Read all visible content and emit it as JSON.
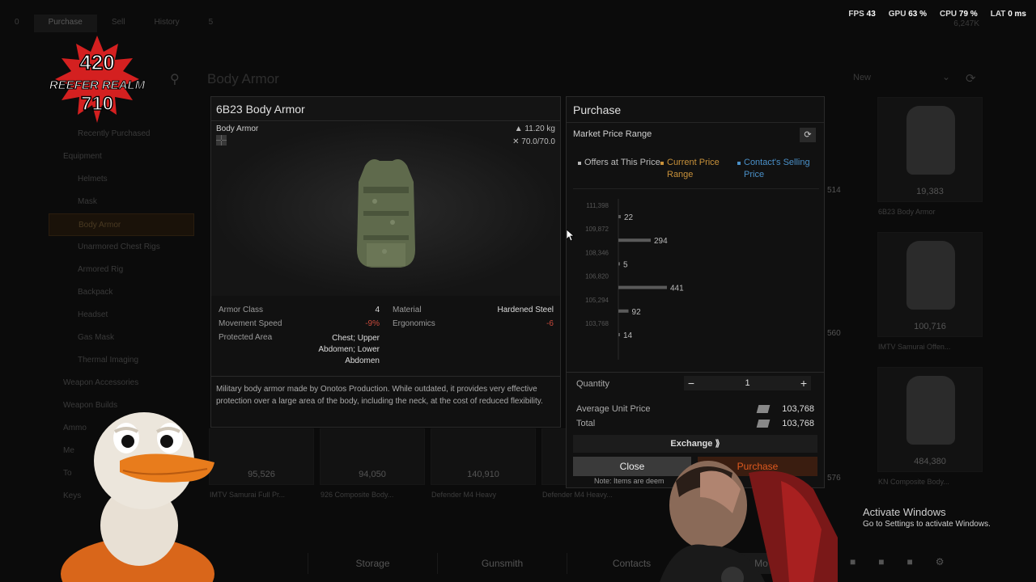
{
  "top_tabs": [
    "0",
    "Purchase",
    "Sell",
    "History",
    "5"
  ],
  "perf": {
    "fps_label": "FPS",
    "fps": "43",
    "gpu_label": "GPU",
    "gpu": "63 %",
    "cpu_label": "CPU",
    "cpu": "79 %",
    "lat_label": "LAT",
    "lat": "0 ms"
  },
  "money_top": "6,247K",
  "background": {
    "page_title": "Body Armor",
    "filter_value": "New",
    "sidebar": {
      "items": [
        {
          "label": "Recently Purchased",
          "type": "item"
        },
        {
          "label": "Equipment",
          "type": "cat"
        },
        {
          "label": "Helmets",
          "type": "item"
        },
        {
          "label": "Mask",
          "type": "item"
        },
        {
          "label": "Body Armor",
          "type": "sel"
        },
        {
          "label": "Unarmored Chest Rigs",
          "type": "item"
        },
        {
          "label": "Armored Rig",
          "type": "item"
        },
        {
          "label": "Backpack",
          "type": "item"
        },
        {
          "label": "Headset",
          "type": "item"
        },
        {
          "label": "Gas Mask",
          "type": "item"
        },
        {
          "label": "Thermal Imaging",
          "type": "item"
        },
        {
          "label": "Weapon Accessories",
          "type": "cat"
        },
        {
          "label": "Weapon Builds",
          "type": "cat"
        },
        {
          "label": "Ammo",
          "type": "cat"
        },
        {
          "label": "Me",
          "type": "cat"
        },
        {
          "label": "To",
          "type": "cat"
        },
        {
          "label": "Keys",
          "type": "cat"
        }
      ]
    },
    "cards_right": [
      {
        "price": "19,383",
        "name": "6B23 Body Armor"
      },
      {
        "price": "100,716",
        "name": "IMTV Samurai Offen..."
      },
      {
        "price": "484,380",
        "name": "KN Composite Body..."
      }
    ],
    "cards_bottom": [
      {
        "price": "95,526",
        "name": "IMTV Samurai Full Pr..."
      },
      {
        "price": "94,050",
        "name": "926 Composite Body..."
      },
      {
        "price": "140,910",
        "name": "Defender M4 Heavy"
      },
      {
        "name": "Defender M4 Heavy..."
      }
    ],
    "partial_prices": [
      "514",
      "560",
      "576"
    ]
  },
  "bottom_nav": [
    "Storage",
    "Gunsmith",
    "Contacts",
    "Mo"
  ],
  "item": {
    "title": "6B23 Body Armor",
    "type": "Body Armor",
    "weight": "11.20 kg",
    "durability": "70.0/70.0",
    "stats_left": [
      {
        "k": "Armor Class",
        "v": "4"
      },
      {
        "k": "Movement Speed",
        "v": "-9%"
      },
      {
        "k": "Protected Area",
        "v": "Chest; Upper Abdomen; Lower Abdomen"
      }
    ],
    "stats_right": [
      {
        "k": "Material",
        "v": "Hardened Steel"
      },
      {
        "k": "Ergonomics",
        "v": "-6"
      }
    ],
    "protected_lines": [
      "Chest; Upper",
      "Abdomen; Lower",
      "Abdomen"
    ],
    "description": "Military body armor made by Onotos Production. While outdated, it provides very effective protection over a large area of the body, including the neck, at the cost of reduced flexibility."
  },
  "purchase": {
    "title": "Purchase",
    "market_range_label": "Market Price Range",
    "legend": [
      {
        "label": "Offers at This Price",
        "color": "#b8b8b8"
      },
      {
        "label": "Current Price Range",
        "color": "#c8913a"
      },
      {
        "label": "Contact's Selling Price",
        "color": "#4a90c8"
      }
    ],
    "quantity_label": "Quantity",
    "quantity": "1",
    "avg_label": "Average Unit Price",
    "avg_value": "103,768",
    "total_label": "Total",
    "total_value": "103,768",
    "exchange_label": "Exchange",
    "close_label": "Close",
    "purchase_label": "Purchase",
    "note": "Note: Items are deem"
  },
  "chart_data": {
    "type": "bar",
    "orientation": "horizontal",
    "categories": [
      "111,398",
      "109,872",
      "108,346",
      "106,820",
      "105,294",
      "103,768"
    ],
    "values": [
      22,
      294,
      5,
      441,
      92,
      14
    ],
    "xlabel": "",
    "ylabel": ""
  },
  "overlays": {
    "logo_lines": [
      "420",
      "REEFER REALM",
      "710"
    ],
    "activate_title": "Activate Windows",
    "activate_sub": "Go to Settings to activate Windows."
  },
  "colors": {
    "accent_orange": "#e05a1f",
    "negative": "#c94a3c"
  }
}
